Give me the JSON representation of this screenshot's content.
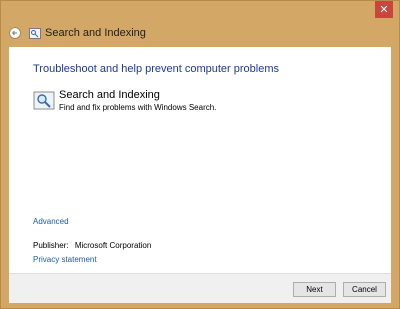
{
  "window": {
    "close_symbol": "✕",
    "title": "Search and Indexing",
    "title_icon": "search-indexing-icon",
    "back_icon": "back-arrow-icon"
  },
  "content": {
    "heading": "Troubleshoot and help prevent computer problems",
    "item": {
      "title": "Search and Indexing",
      "description": "Find and fix problems with Windows Search.",
      "icon": "magnifier-icon"
    },
    "advanced_link": "Advanced",
    "publisher_label": "Publisher:",
    "publisher_value": "Microsoft Corporation",
    "privacy_link": "Privacy statement"
  },
  "footer": {
    "next_label": "Next",
    "cancel_label": "Cancel"
  },
  "colors": {
    "frame": "#d3a866",
    "close_button": "#c9463d",
    "heading": "#1e3a96",
    "link": "#1a5ea8",
    "footer_bg": "#f0f0f0"
  }
}
